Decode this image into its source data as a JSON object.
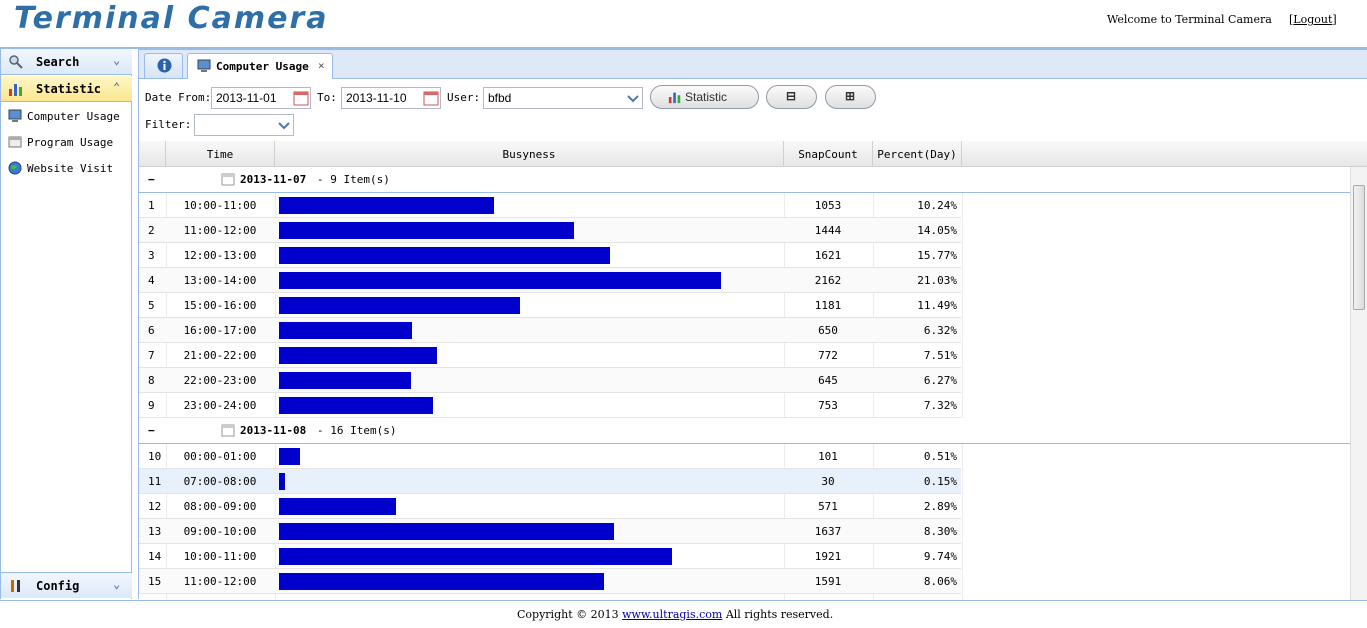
{
  "app": {
    "title": "Terminal Camera",
    "welcome": "Welcome to Terminal Camera",
    "logout_label": "Logout"
  },
  "sidebar": {
    "search_label": "Search",
    "statistic_label": "Statistic",
    "config_label": "Config",
    "items": [
      {
        "label": "Computer Usage"
      },
      {
        "label": "Program Usage"
      },
      {
        "label": "Website Visit"
      }
    ]
  },
  "tabs": {
    "active_label": "Computer Usage",
    "close_glyph": "×"
  },
  "toolbar": {
    "date_from_label": "Date From:",
    "date_from": "2013-11-01",
    "to_label": "To:",
    "date_to": "2013-11-10",
    "user_label": "User:",
    "user": "bfbd",
    "statistic_button": "Statistic",
    "filter_label": "Filter:",
    "filter": ""
  },
  "grid": {
    "headers": {
      "time": "Time",
      "busyness": "Busyness",
      "snapcount": "SnapCount",
      "percent": "Percent(Day)"
    },
    "groups": [
      {
        "date": "2013-11-07",
        "count_text": "- 9 Item(s)",
        "rows": [
          {
            "no": "1",
            "time": "10:00-11:00",
            "busyness": 1053,
            "snap": "1053",
            "pct": "10.24%"
          },
          {
            "no": "2",
            "time": "11:00-12:00",
            "busyness": 1444,
            "snap": "1444",
            "pct": "14.05%"
          },
          {
            "no": "3",
            "time": "12:00-13:00",
            "busyness": 1621,
            "snap": "1621",
            "pct": "15.77%"
          },
          {
            "no": "4",
            "time": "13:00-14:00",
            "busyness": 2162,
            "snap": "2162",
            "pct": "21.03%"
          },
          {
            "no": "5",
            "time": "15:00-16:00",
            "busyness": 1181,
            "snap": "1181",
            "pct": "11.49%"
          },
          {
            "no": "6",
            "time": "16:00-17:00",
            "busyness": 650,
            "snap": "650",
            "pct": "6.32%"
          },
          {
            "no": "7",
            "time": "21:00-22:00",
            "busyness": 772,
            "snap": "772",
            "pct": "7.51%"
          },
          {
            "no": "8",
            "time": "22:00-23:00",
            "busyness": 645,
            "snap": "645",
            "pct": "6.27%"
          },
          {
            "no": "9",
            "time": "23:00-24:00",
            "busyness": 753,
            "snap": "753",
            "pct": "7.32%"
          }
        ]
      },
      {
        "date": "2013-11-08",
        "count_text": "- 16 Item(s)",
        "rows": [
          {
            "no": "10",
            "time": "00:00-01:00",
            "busyness": 101,
            "snap": "101",
            "pct": "0.51%"
          },
          {
            "no": "11",
            "time": "07:00-08:00",
            "busyness": 30,
            "snap": "30",
            "pct": "0.15%",
            "selected": true
          },
          {
            "no": "12",
            "time": "08:00-09:00",
            "busyness": 571,
            "snap": "571",
            "pct": "2.89%"
          },
          {
            "no": "13",
            "time": "09:00-10:00",
            "busyness": 1637,
            "snap": "1637",
            "pct": "8.30%"
          },
          {
            "no": "14",
            "time": "10:00-11:00",
            "busyness": 1921,
            "snap": "1921",
            "pct": "9.74%"
          },
          {
            "no": "15",
            "time": "11:00-12:00",
            "busyness": 1591,
            "snap": "1591",
            "pct": "8.06%"
          }
        ]
      }
    ]
  },
  "footer": {
    "prefix": "Copyright © 2013",
    "link": "www.ultragis.com",
    "suffix": "All rights reserved."
  },
  "colors": {
    "bar": "#0000cd",
    "accent": "#99bbe8",
    "logo": "#2f6fa8"
  }
}
